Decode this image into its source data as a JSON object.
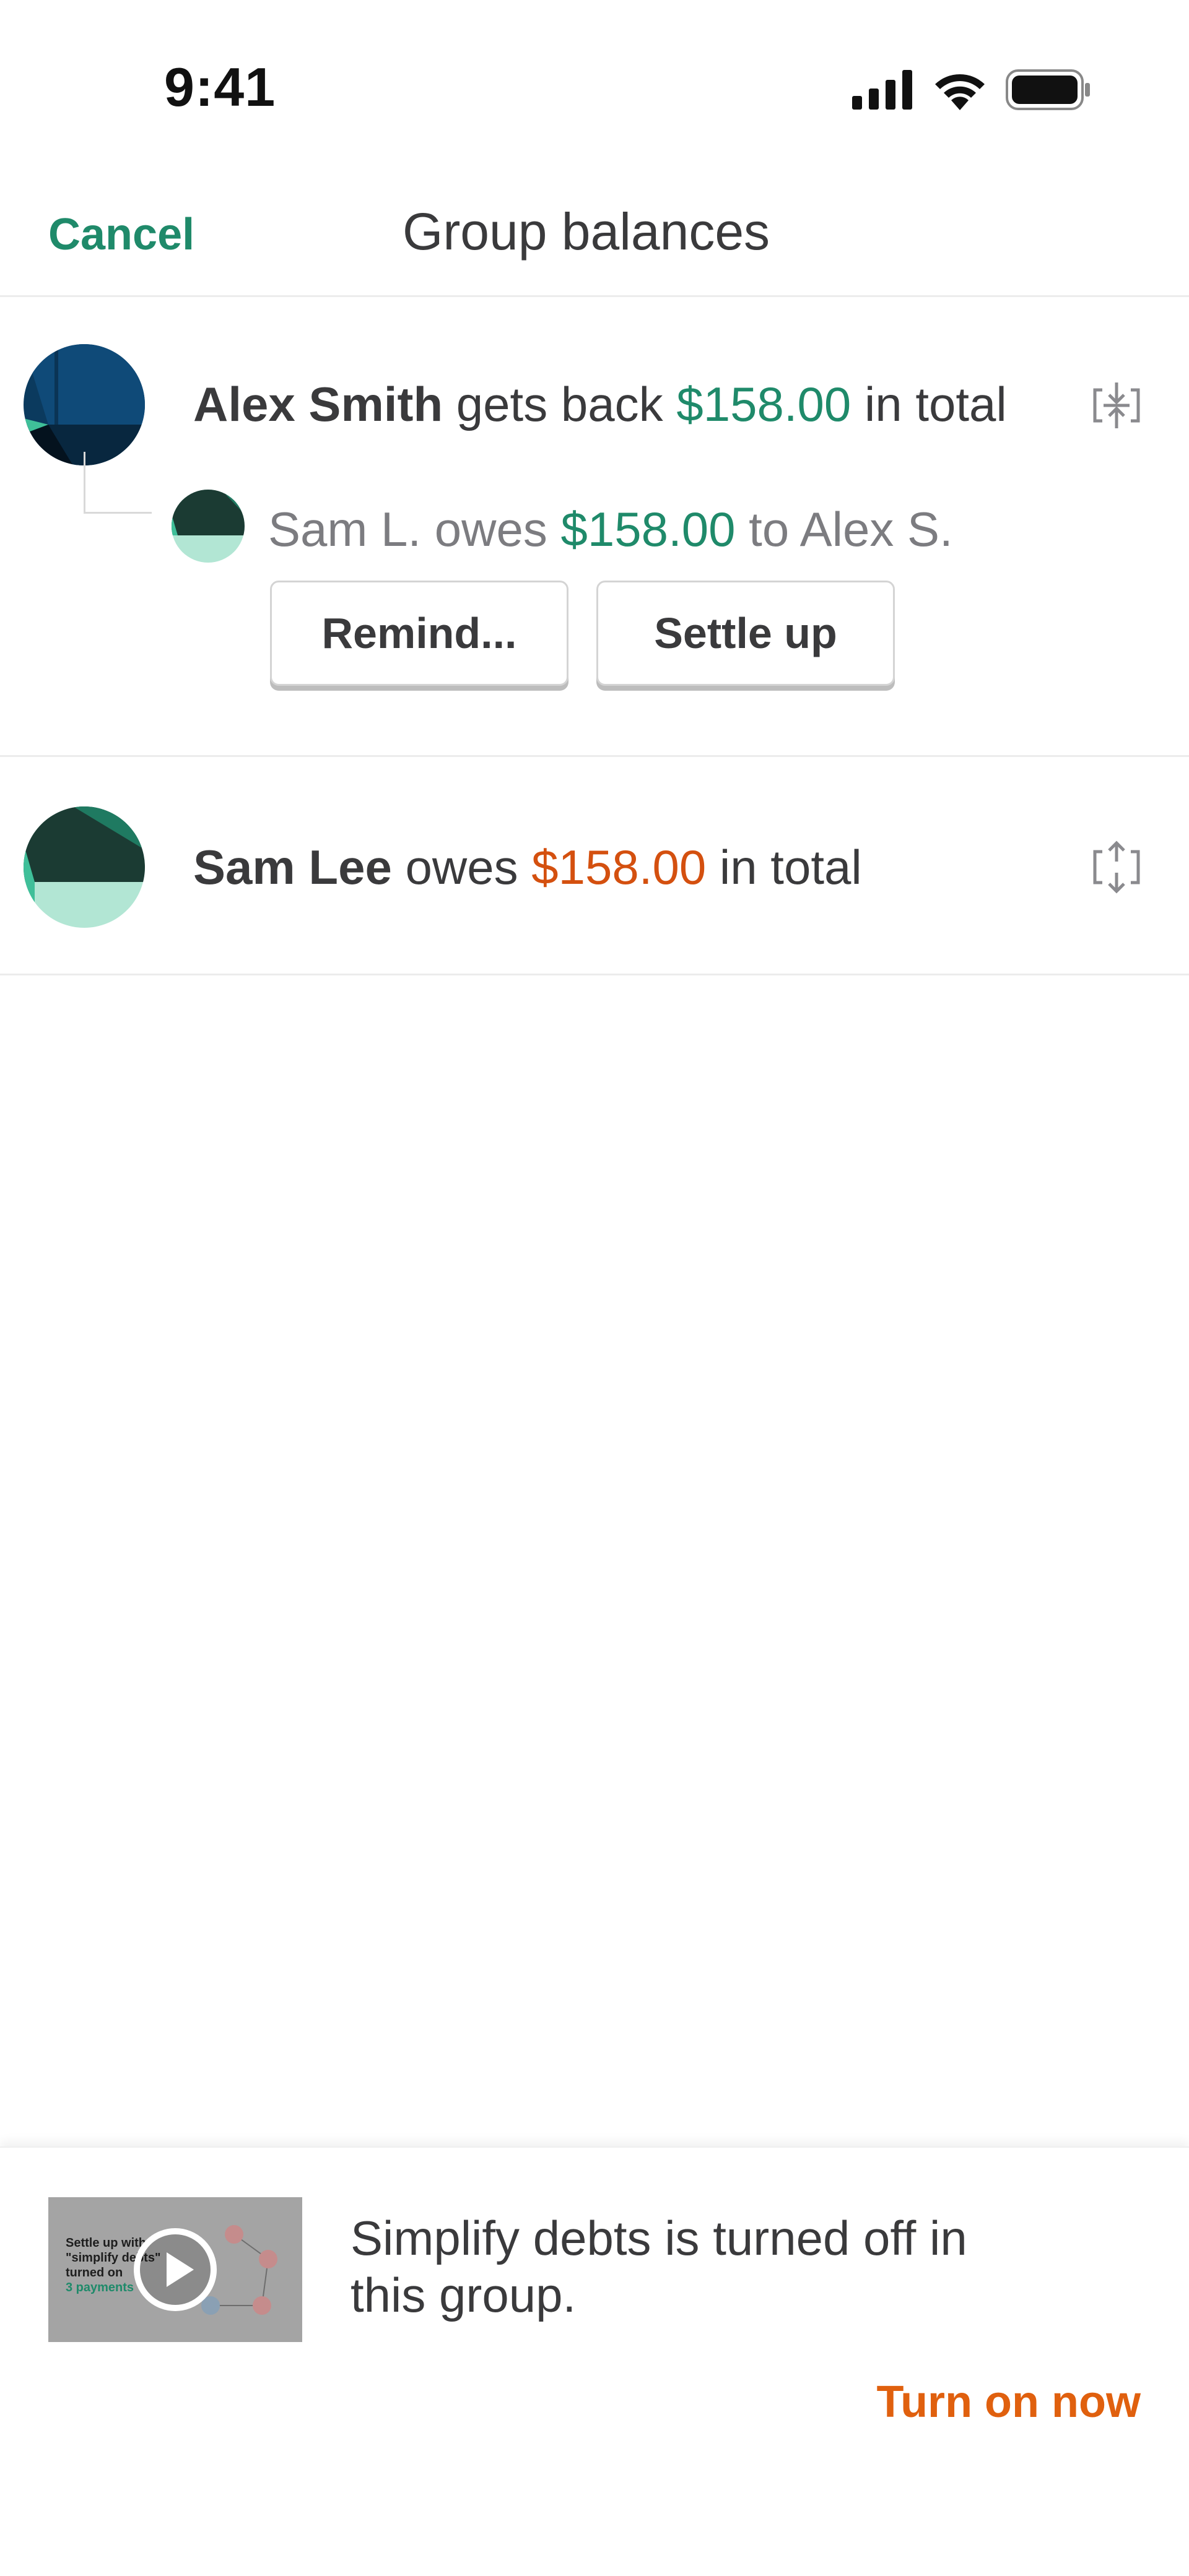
{
  "status_bar": {
    "time": "9:41",
    "icons": [
      "cellular-signal-icon",
      "wifi-icon",
      "battery-icon"
    ]
  },
  "nav": {
    "cancel_label": "Cancel",
    "title": "Group balances"
  },
  "balances": [
    {
      "name": "Alex Smith",
      "verb": "gets back",
      "amount": "$158.00",
      "suffix": "in total",
      "amount_color": "#1f8a6a",
      "details": [
        {
          "debtor": "Sam L. owes",
          "amount": "$158.00",
          "creditor": "to Alex S."
        }
      ],
      "actions": {
        "remind_label": "Remind...",
        "settle_label": "Settle up"
      }
    },
    {
      "name": "Sam Lee",
      "verb": "owes",
      "amount": "$158.00",
      "suffix": "in total",
      "amount_color": "#d4500f"
    }
  ],
  "banner": {
    "video_thumb": {
      "line1": "Settle up with",
      "line2": "\"simplify debts\"",
      "line3": "turned on",
      "line4": "3 payments"
    },
    "message": "Simplify debts is turned off in this group.",
    "action_label": "Turn on now"
  },
  "colors": {
    "brand_green": "#1f8a6a",
    "owes_orange": "#d4500f",
    "link_orange": "#e0600e"
  }
}
